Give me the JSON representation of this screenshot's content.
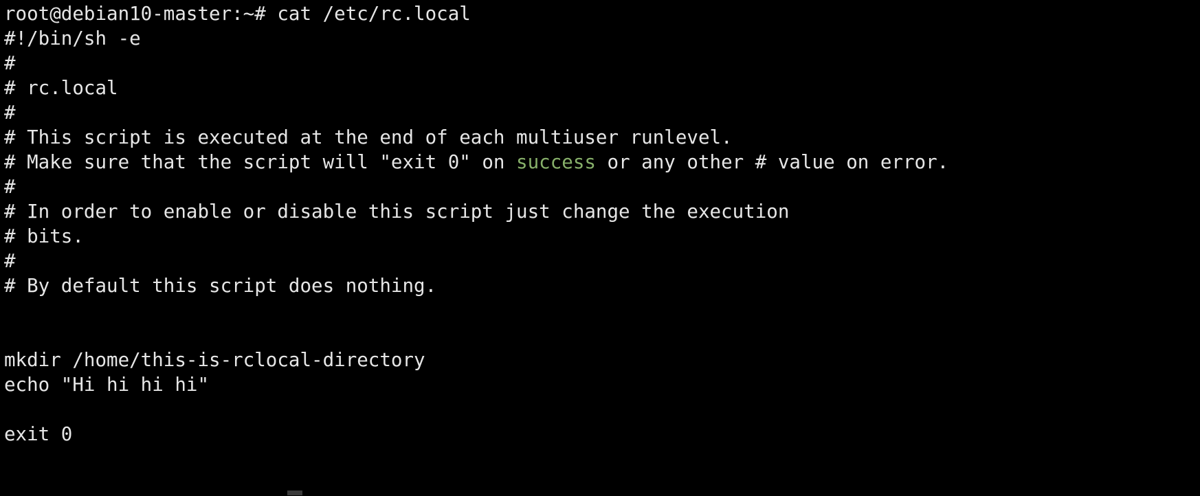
{
  "terminal": {
    "window_title": "root@debian10-master: ~",
    "background_color": "#000000",
    "foreground_color": "#e6e6e6",
    "accent_green": "#87b06a",
    "prompt": {
      "user": "root",
      "host": "debian10-master",
      "cwd": "~",
      "symbol": "#",
      "full": "root@debian10-master:~#"
    },
    "command": "cat /etc/rc.local",
    "lines": [
      {
        "id": "line-prompt",
        "segments": [
          {
            "text": "root@debian10-master:~# cat /etc/rc.local",
            "color": "default"
          }
        ]
      },
      {
        "id": "line-shebang",
        "segments": [
          {
            "text": "#!/bin/sh -e",
            "color": "default"
          }
        ]
      },
      {
        "id": "line-hash-1",
        "segments": [
          {
            "text": "#",
            "color": "default"
          }
        ]
      },
      {
        "id": "line-rclocal",
        "segments": [
          {
            "text": "# rc.local",
            "color": "default"
          }
        ]
      },
      {
        "id": "line-hash-2",
        "segments": [
          {
            "text": "#",
            "color": "default"
          }
        ]
      },
      {
        "id": "line-this-script",
        "segments": [
          {
            "text": "# This script is executed at the end of each multiuser runlevel.",
            "color": "default"
          }
        ]
      },
      {
        "id": "line-make-sure",
        "segments": [
          {
            "text": "# Make sure that the script will \"exit 0\" on ",
            "color": "default"
          },
          {
            "text": "success",
            "color": "green"
          },
          {
            "text": " or any other # value on error.",
            "color": "default"
          }
        ]
      },
      {
        "id": "line-hash-3",
        "segments": [
          {
            "text": "#",
            "color": "default"
          }
        ]
      },
      {
        "id": "line-in-order",
        "segments": [
          {
            "text": "# In order to enable or disable this script just change the execution",
            "color": "default"
          }
        ]
      },
      {
        "id": "line-bits",
        "segments": [
          {
            "text": "# bits.",
            "color": "default"
          }
        ]
      },
      {
        "id": "line-hash-4",
        "segments": [
          {
            "text": "#",
            "color": "default"
          }
        ]
      },
      {
        "id": "line-by-default",
        "segments": [
          {
            "text": "# By default this script does nothing.",
            "color": "default"
          }
        ]
      },
      {
        "id": "line-blank-1",
        "segments": [
          {
            "text": "",
            "color": "default"
          }
        ]
      },
      {
        "id": "line-blank-2",
        "segments": [
          {
            "text": "",
            "color": "default"
          }
        ]
      },
      {
        "id": "line-mkdir",
        "segments": [
          {
            "text": "mkdir /home/this-is-rclocal-directory",
            "color": "default"
          }
        ]
      },
      {
        "id": "line-echo",
        "segments": [
          {
            "text": "echo \"Hi hi hi hi\"",
            "color": "default"
          }
        ]
      },
      {
        "id": "line-blank-3",
        "segments": [
          {
            "text": "",
            "color": "default"
          }
        ]
      },
      {
        "id": "line-exit",
        "segments": [
          {
            "text": "exit 0",
            "color": "default"
          }
        ]
      }
    ]
  }
}
